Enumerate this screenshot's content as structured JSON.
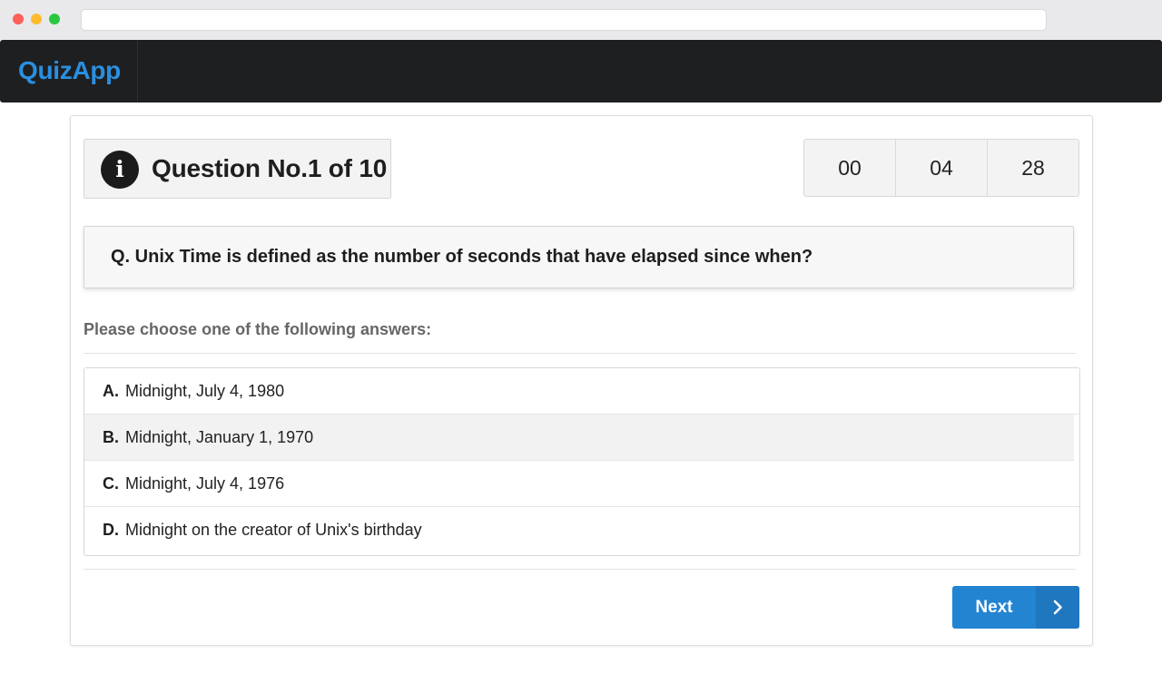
{
  "app": {
    "brand": "QuizApp"
  },
  "quiz": {
    "heading": "Question No.1 of 10",
    "timer": [
      "00",
      "04",
      "28"
    ],
    "question": "Q. Unix Time is defined as the number of seconds that have elapsed since when?",
    "prompt": "Please choose one of the following answers:",
    "answers": [
      {
        "letter": "A.",
        "text": "Midnight, July 4, 1980"
      },
      {
        "letter": "B.",
        "text": "Midnight, January 1, 1970"
      },
      {
        "letter": "C.",
        "text": "Midnight, July 4, 1976"
      },
      {
        "letter": "D.",
        "text": "Midnight on the creator of Unix's birthday"
      }
    ],
    "hovered_answer": "B.",
    "next_label": "Next"
  },
  "icons": {
    "info": "info-icon",
    "next": "chevron-right-icon"
  },
  "colors": {
    "brand": "#2a8fe0",
    "navbar": "#1e1f21",
    "button": "#2384d2"
  }
}
